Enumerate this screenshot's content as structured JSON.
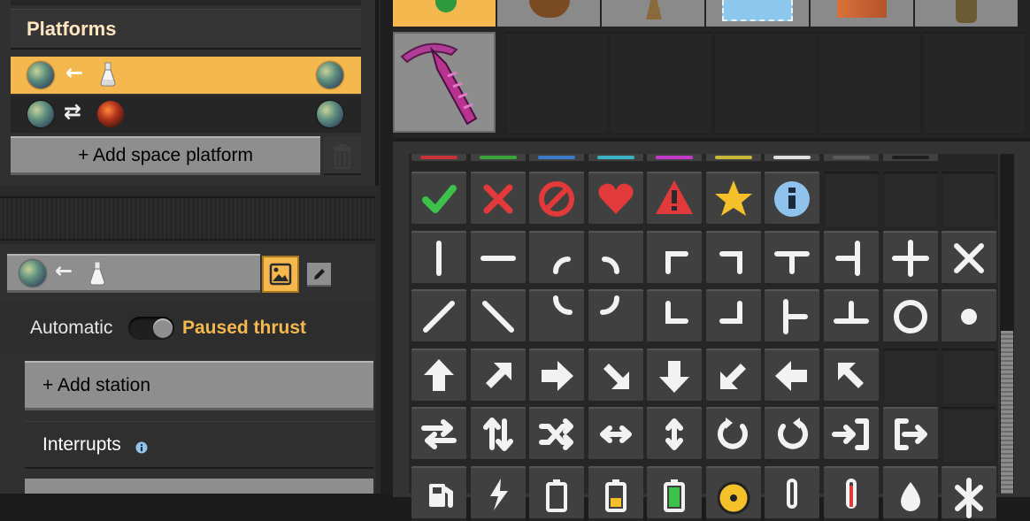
{
  "platforms_panel": {
    "title": "Platforms",
    "add_button_label": "+ Add space platform",
    "rows": [
      {
        "selected": true,
        "left_icon": "planet-icon",
        "arrow": "←",
        "right_icon": "science-flask-icon",
        "end_icon": "planet-icon"
      },
      {
        "selected": false,
        "left_icon": "planet-icon",
        "arrow": "⇄",
        "right_icon": "lava-planet-icon",
        "end_icon": "planet-icon"
      }
    ]
  },
  "platform_detail": {
    "automatic_label": "Automatic",
    "paused_label": "Paused thrust",
    "add_station_label": "+ Add station",
    "interrupts_label": "Interrupts",
    "accent_color": "#f4b84f",
    "paused_color": "#f4b84f"
  },
  "icon_grid": {
    "rows": [
      [
        "check-icon",
        "x-icon",
        "no-entry-icon",
        "heart-icon",
        "warning-icon",
        "star-icon",
        "info-icon",
        "",
        "",
        ""
      ],
      [
        "line-vertical-icon",
        "line-horizontal-icon",
        "curve-left-icon",
        "curve-right-icon",
        "corner-top-left-icon",
        "corner-top-right-icon",
        "t-down-icon",
        "t-left-icon",
        "plus-icon",
        "cross-icon"
      ],
      [
        "diagonal-up-icon",
        "diagonal-down-icon",
        "curve-bottom-left-icon",
        "curve-bottom-right-icon",
        "corner-bottom-left-icon",
        "corner-bottom-right-icon",
        "t-right-icon",
        "t-up-icon",
        "circle-icon",
        "dot-icon"
      ],
      [
        "arrow-up-icon",
        "arrow-up-right-icon",
        "arrow-right-icon",
        "arrow-down-right-icon",
        "arrow-down-icon",
        "arrow-down-left-icon",
        "arrow-left-icon",
        "arrow-up-left-icon",
        "",
        ""
      ],
      [
        "swap-horizontal-icon",
        "swap-vertical-icon",
        "shuffle-icon",
        "left-right-icon",
        "up-down-icon",
        "rotate-cw-icon",
        "rotate-ccw-icon",
        "enter-icon",
        "exit-icon",
        ""
      ],
      [
        "fuel-icon",
        "lightning-icon",
        "battery-empty-icon",
        "battery-half-icon",
        "battery-full-icon",
        "radiation-icon",
        "thermometer-low-icon",
        "thermometer-high-icon",
        "drop-icon",
        "snowflake-icon"
      ]
    ]
  }
}
